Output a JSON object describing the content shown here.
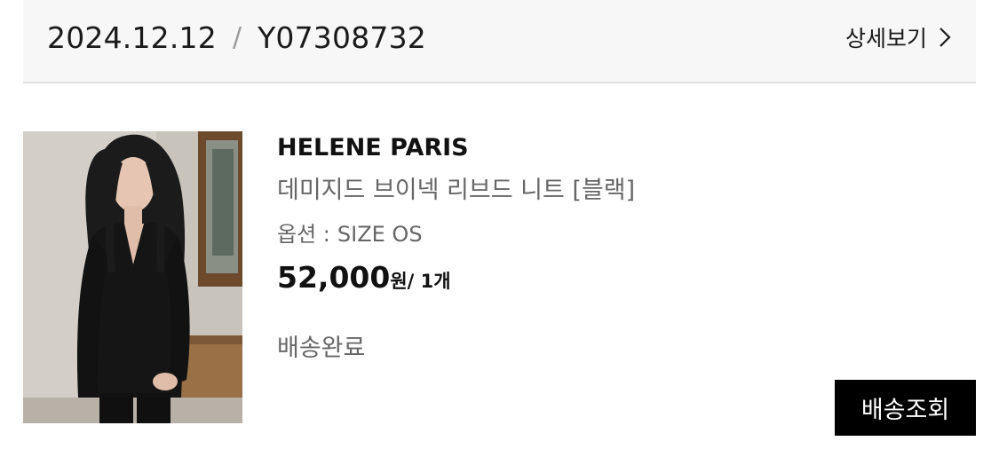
{
  "order": {
    "date": "2024.12.12",
    "separator": "/",
    "number": "Y07308732",
    "detail_link_label": "상세보기"
  },
  "product": {
    "brand": "HELENE PARIS",
    "name": "데미지드 브이넥 리브드 니트 [블랙]",
    "option_label": "옵션 :",
    "option_value": "SIZE OS",
    "price": "52,000",
    "price_unit": "원",
    "quantity": "/ 1개",
    "status": "배송완료",
    "image": "product-photo"
  },
  "actions": {
    "track_button_label": "배송조회"
  },
  "colors": {
    "header_bg": "#f7f7f7",
    "primary_text": "#111111",
    "secondary_text": "#666666",
    "button_bg": "#000000",
    "button_text": "#ffffff"
  }
}
